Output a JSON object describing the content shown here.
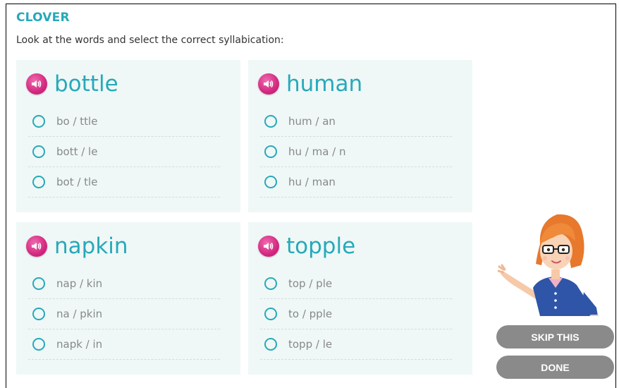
{
  "app": {
    "title": "CLOVER"
  },
  "instruction": "Look at the words and select the correct syllabication:",
  "questions": [
    {
      "word": "bottle",
      "options": [
        "bo / ttle",
        "bott / le",
        "bot / tle"
      ]
    },
    {
      "word": "human",
      "options": [
        "hum / an",
        "hu / ma / n",
        "hu / man"
      ]
    },
    {
      "word": "napkin",
      "options": [
        "nap / kin",
        "na / pkin",
        "napk / in"
      ]
    },
    {
      "word": "topple",
      "options": [
        "top / ple",
        "to / pple",
        "topp / le"
      ]
    }
  ],
  "buttons": {
    "skip": "SKIP THIS",
    "done": "DONE"
  },
  "colors": {
    "accent": "#27a9b9",
    "speaker": "#d3287f",
    "card_bg": "#eff8f7",
    "button_bg": "#8a8a8a"
  },
  "icons": {
    "speaker": "speaker-icon",
    "radio": "radio-icon"
  }
}
